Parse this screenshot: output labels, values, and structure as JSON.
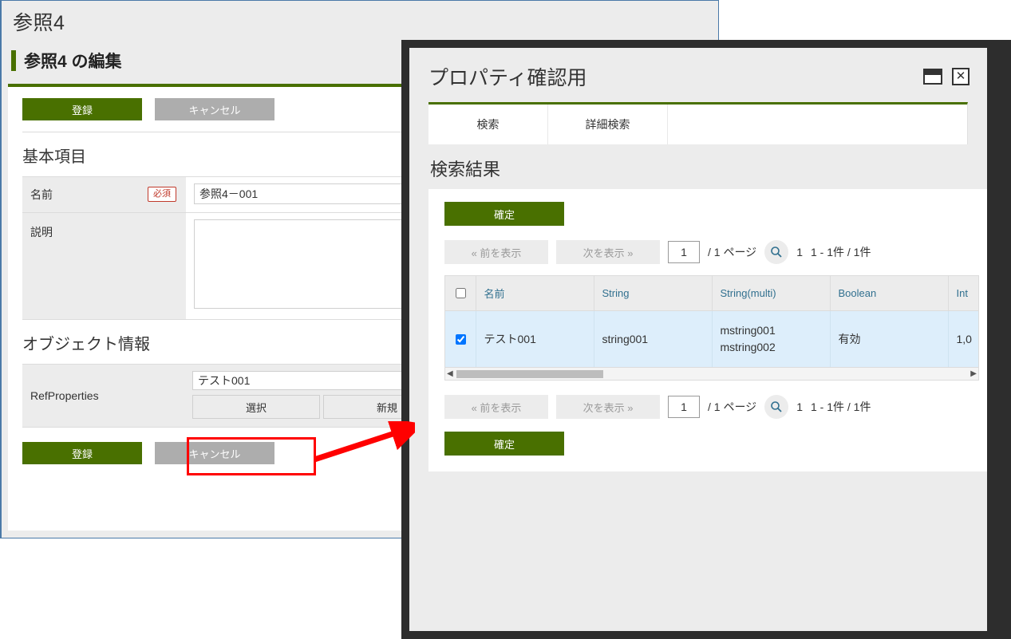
{
  "background_page": {
    "title": "参照4",
    "section_heading": "参照4 の編集",
    "top_buttons": {
      "submit": "登録",
      "cancel": "キャンセル"
    },
    "bottom_buttons": {
      "submit": "登録",
      "cancel": "キャンセル"
    },
    "basic_section": {
      "heading": "基本項目",
      "name_label": "名前",
      "required_badge": "必須",
      "name_value": "参照4－001",
      "desc_label": "説明",
      "desc_value": ""
    },
    "object_section": {
      "heading": "オブジェクト情報",
      "ref_label": "RefProperties",
      "ref_value": "テスト001",
      "select_button": "選択",
      "new_button": "新規"
    }
  },
  "modal": {
    "title": "プロパティ確認用",
    "window_controls": {
      "maximize": "maximize-icon",
      "close": "✕"
    },
    "tabs": [
      {
        "label": "検索"
      },
      {
        "label": "詳細検索"
      }
    ],
    "result_heading": "検索結果",
    "confirm_button_top": "確定",
    "confirm_button_bottom": "確定",
    "pager_top": {
      "prev": "« 前を表示",
      "next": "次を表示 »",
      "page_value": "1",
      "page_total": "/ 1 ページ",
      "search_icon": "search-icon",
      "page_number": "1",
      "record_count": "1 - 1件 / 1件"
    },
    "pager_bottom": {
      "prev": "« 前を表示",
      "next": "次を表示 »",
      "page_value": "1",
      "page_total": "/ 1 ページ",
      "search_icon": "search-icon",
      "page_number": "1",
      "record_count": "1 - 1件 / 1件"
    },
    "table": {
      "columns": [
        "名前",
        "String",
        "String(multi)",
        "Boolean",
        "Int"
      ],
      "rows": [
        {
          "checked": true,
          "name": "テスト001",
          "string": "string001",
          "string_multi_1": "mstring001",
          "string_multi_2": "mstring002",
          "boolean": "有効",
          "int": "1,0"
        }
      ]
    }
  },
  "colors": {
    "accent_green": "#497000",
    "annotation_red": "#ff0000",
    "modal_border": "#2d2d2d",
    "row_highlight": "#ddeefb",
    "header_text": "#31708f"
  }
}
